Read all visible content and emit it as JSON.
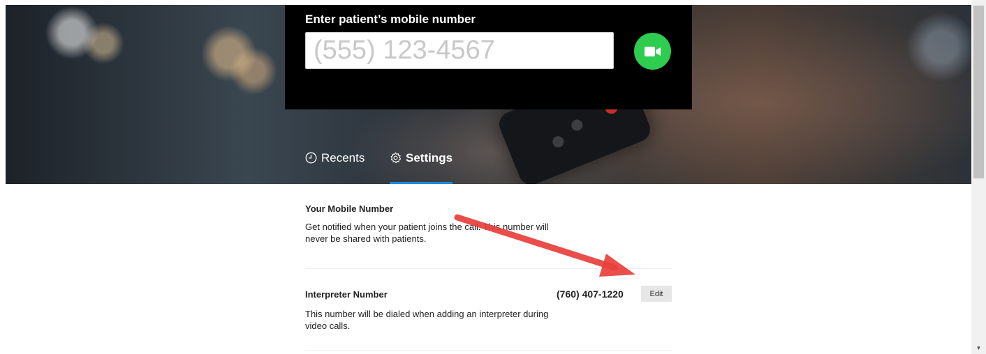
{
  "dial": {
    "title": "Enter patient’s mobile number",
    "placeholder": "(555) 123-4567",
    "value": "",
    "video_icon": "video-camera-icon"
  },
  "tabs": [
    {
      "label": "Recents",
      "icon": "clock-icon",
      "active": false
    },
    {
      "label": "Settings",
      "icon": "gear-icon",
      "active": true
    }
  ],
  "settings": {
    "mobile": {
      "title": "Your Mobile Number",
      "description": "Get notified when your patient joins the call. This number will never be shared with patients."
    },
    "interpreter": {
      "title": "Interpreter Number",
      "number": "(760) 407-1220",
      "edit_label": "Edit",
      "description": "This number will be dialed when adding an interpreter during video calls."
    }
  },
  "colors": {
    "accent": "#1c8adb",
    "video_button": "#2ecc4f",
    "annotation_arrow": "#e8403c"
  }
}
